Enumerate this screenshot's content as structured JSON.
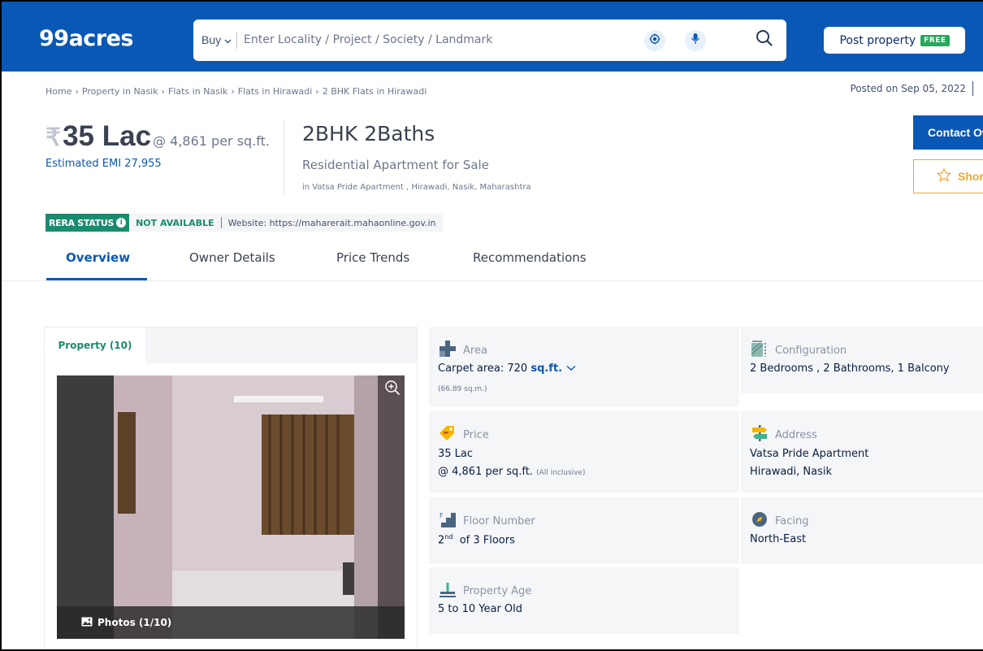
{
  "header": {
    "logo": "99acres",
    "search": {
      "type_label": "Buy",
      "placeholder": "Enter Locality / Project / Society / Landmark"
    },
    "post_property": {
      "label": "Post property",
      "badge": "FREE"
    }
  },
  "breadcrumb": [
    "Home",
    "Property in Nasik",
    "Flats in Nasik",
    "Flats in Hirawadi",
    "2 BHK Flats in Hirawadi"
  ],
  "posted_on": "Posted on Sep 05, 2022",
  "price": {
    "amount": "35 Lac",
    "per_sqft": "@ 4,861 per sq.ft.",
    "emi": "Estimated EMI  27,955"
  },
  "listing": {
    "title": "2BHK 2Baths",
    "subtitle": "Residential Apartment for Sale",
    "location": "in Vatsa Pride Apartment , Hirawadi, Nasik, Maharashtra"
  },
  "actions": {
    "contact": "Contact Owner",
    "shortlist": "Shortlist"
  },
  "rera": {
    "status_label": "RERA STATUS",
    "value": "NOT AVAILABLE",
    "website": "Website: https://maharerait.mahaonline.gov.in"
  },
  "tabs": [
    "Overview",
    "Owner Details",
    "Price Trends",
    "Recommendations"
  ],
  "gallery": {
    "tab": "Property (10)",
    "photos_label": "Photos (1/10)"
  },
  "details": {
    "area": {
      "label": "Area",
      "value": "Carpet area: 720",
      "unit": "sq.ft.",
      "sub": "(66.89 sq.m.)"
    },
    "configuration": {
      "label": "Configuration",
      "value": "2 Bedrooms , 2 Bathrooms, 1 Balcony"
    },
    "price": {
      "label": "Price",
      "value": " 35 Lac",
      "per": "@ 4,861 per sq.ft.",
      "note": "(All inclusive)"
    },
    "address": {
      "label": "Address",
      "line1": "Vatsa Pride Apartment",
      "line2": "Hirawadi, Nasik"
    },
    "floor": {
      "label": "Floor Number",
      "floor_num": "2",
      "floor_suffix": "nd",
      "floor_total": "of 3 Floors"
    },
    "facing": {
      "label": "Facing",
      "value": "North-East"
    },
    "age": {
      "label": "Property Age",
      "value": "5 to 10 Year Old"
    }
  }
}
